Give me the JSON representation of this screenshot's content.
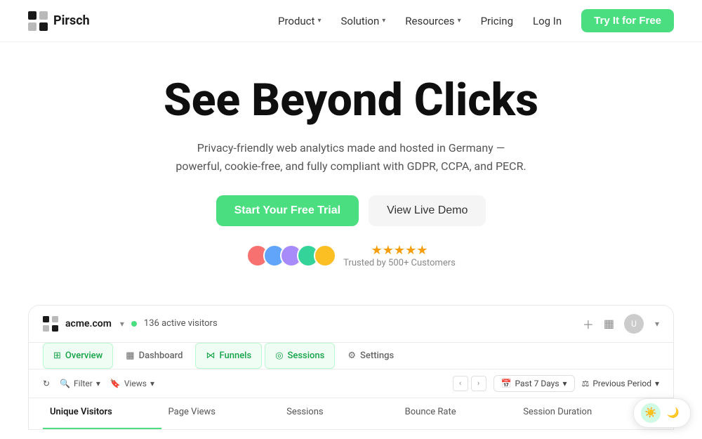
{
  "nav": {
    "logo_text": "Pirsch",
    "links": [
      {
        "label": "Product",
        "has_dropdown": true
      },
      {
        "label": "Solution",
        "has_dropdown": true
      },
      {
        "label": "Resources",
        "has_dropdown": true
      },
      {
        "label": "Pricing",
        "has_dropdown": false
      }
    ],
    "login_label": "Log In",
    "try_label": "Try It for Free"
  },
  "hero": {
    "title": "See Beyond Clicks",
    "subtitle": "Privacy-friendly web analytics made and hosted in Germany — powerful, cookie-free, and fully compliant with GDPR, CCPA, and PECR.",
    "primary_cta": "Start Your Free Trial",
    "secondary_cta": "View Live Demo",
    "trust_text": "Trusted by 500+ Customers",
    "stars": "★★★★★"
  },
  "dashboard": {
    "site_name": "acme.com",
    "site_dropdown": "▾",
    "active_visitors_label": "136 active visitors",
    "tabs": [
      {
        "label": "Overview",
        "icon": "⊞",
        "active": true
      },
      {
        "label": "Dashboard",
        "icon": "▦",
        "active": false
      },
      {
        "label": "Funnels",
        "icon": "⋈",
        "active": false
      },
      {
        "label": "Sessions",
        "icon": "◎",
        "active": true
      },
      {
        "label": "Settings",
        "icon": "⚙",
        "active": false
      }
    ],
    "toolbar": {
      "refresh_icon": "↻",
      "filter_label": "Filter",
      "views_label": "Views",
      "date_range": "Past 7 Days",
      "compare_label": "Previous Period"
    },
    "stats": [
      {
        "label": "Unique Visitors",
        "active": true
      },
      {
        "label": "Page Views",
        "active": false
      },
      {
        "label": "Sessions",
        "active": false
      },
      {
        "label": "Bounce Rate",
        "active": false
      },
      {
        "label": "Session Duration",
        "active": false
      }
    ]
  },
  "colors": {
    "green_accent": "#4ade80",
    "green_dark": "#16a34a",
    "green_bg": "#f0fdf4",
    "green_border": "#bbf7d0"
  }
}
